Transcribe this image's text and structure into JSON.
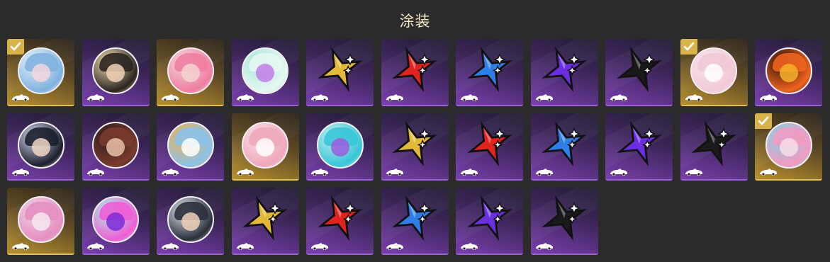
{
  "title": "涂装",
  "accent": "#d8b34c",
  "colors": {
    "gold": "#e4b937",
    "red": "#e0231f",
    "blue": "#2f7de6",
    "purple": "#6a2ee0",
    "black": "#1a1a1a"
  },
  "tiles": [
    {
      "type": "portrait",
      "frame": "gold",
      "selected": true,
      "icon": "character-portrait-icon",
      "palette": [
        "#e9f3fb",
        "#7fb2e0",
        "#f4d6df"
      ]
    },
    {
      "type": "portrait",
      "frame": "purple",
      "selected": false,
      "icon": "character-portrait-icon",
      "palette": [
        "#f3e2b3",
        "#2b2420",
        "#f2d2b6"
      ]
    },
    {
      "type": "portrait",
      "frame": "gold",
      "selected": false,
      "icon": "character-portrait-icon",
      "palette": [
        "#f4d7df",
        "#ef7ea0",
        "#f5d3d0"
      ]
    },
    {
      "type": "portrait",
      "frame": "purple",
      "selected": false,
      "icon": "abstract-emblem-icon",
      "palette": [
        "#a6e7dc",
        "#e6f7f1",
        "#c27de8"
      ]
    },
    {
      "type": "star",
      "frame": "purple",
      "selected": false,
      "icon": "gold-star-icon",
      "color": "gold"
    },
    {
      "type": "star",
      "frame": "purple",
      "selected": false,
      "icon": "red-star-icon",
      "color": "red"
    },
    {
      "type": "star",
      "frame": "purple",
      "selected": false,
      "icon": "blue-star-icon",
      "color": "blue"
    },
    {
      "type": "star",
      "frame": "purple",
      "selected": false,
      "icon": "purple-star-icon",
      "color": "purple"
    },
    {
      "type": "star",
      "frame": "purple",
      "selected": false,
      "icon": "black-star-icon",
      "color": "black"
    },
    {
      "type": "portrait",
      "frame": "gold",
      "selected": true,
      "icon": "character-portrait-icon",
      "palette": [
        "#f6e6ec",
        "#f2c9d6",
        "#ffffff"
      ]
    },
    {
      "type": "portrait",
      "frame": "purple",
      "selected": false,
      "icon": "fire-emblem-icon",
      "palette": [
        "#2a120e",
        "#f0641e",
        "#f6b12a"
      ]
    },
    {
      "type": "portrait",
      "frame": "purple",
      "selected": false,
      "icon": "character-portrait-icon",
      "palette": [
        "#d5d9ef",
        "#1b1e2c",
        "#f1d5c4"
      ]
    },
    {
      "type": "portrait",
      "frame": "purple",
      "selected": false,
      "icon": "character-portrait-icon",
      "palette": [
        "#2a1d1a",
        "#7a3a2e",
        "#e8c3a8"
      ]
    },
    {
      "type": "portrait",
      "frame": "purple",
      "selected": false,
      "icon": "character-portrait-icon",
      "palette": [
        "#f3b04a",
        "#8bc3ea",
        "#ffffff"
      ]
    },
    {
      "type": "portrait",
      "frame": "gold",
      "selected": false,
      "icon": "character-portrait-icon",
      "palette": [
        "#f6dfe6",
        "#f0a7bb",
        "#ffffff"
      ]
    },
    {
      "type": "portrait",
      "frame": "purple",
      "selected": false,
      "icon": "abstract-emblem-icon",
      "palette": [
        "#bff0ea",
        "#38c5d8",
        "#9b5ce0"
      ]
    },
    {
      "type": "star",
      "frame": "purple",
      "selected": false,
      "icon": "gold-star-icon",
      "color": "gold"
    },
    {
      "type": "star",
      "frame": "purple",
      "selected": false,
      "icon": "red-star-icon",
      "color": "red"
    },
    {
      "type": "star",
      "frame": "purple",
      "selected": false,
      "icon": "blue-star-icon",
      "color": "blue"
    },
    {
      "type": "star",
      "frame": "purple",
      "selected": false,
      "icon": "purple-star-icon",
      "color": "purple"
    },
    {
      "type": "star",
      "frame": "purple",
      "selected": false,
      "icon": "black-star-icon",
      "color": "black"
    },
    {
      "type": "portrait",
      "frame": "gold",
      "selected": true,
      "icon": "character-portrait-icon",
      "palette": [
        "#7fd3e8",
        "#f39ac0",
        "#f7dde8"
      ]
    },
    {
      "type": "portrait",
      "frame": "gold",
      "selected": false,
      "icon": "character-portrait-icon",
      "palette": [
        "#f1cfe3",
        "#e58fc1",
        "#f7e7f0"
      ]
    },
    {
      "type": "portrait",
      "frame": "purple",
      "selected": false,
      "icon": "cat-emblem-icon",
      "palette": [
        "#a9f0e4",
        "#f05cd6",
        "#7d2ad8"
      ]
    },
    {
      "type": "portrait",
      "frame": "purple",
      "selected": false,
      "icon": "character-portrait-icon",
      "palette": [
        "#d9e3ea",
        "#2a2f3a",
        "#f0d1b8"
      ]
    },
    {
      "type": "star",
      "frame": "purple",
      "selected": false,
      "icon": "gold-star-icon",
      "color": "gold"
    },
    {
      "type": "star",
      "frame": "purple",
      "selected": false,
      "icon": "red-star-icon",
      "color": "red"
    },
    {
      "type": "star",
      "frame": "purple",
      "selected": false,
      "icon": "blue-star-icon",
      "color": "blue"
    },
    {
      "type": "star",
      "frame": "purple",
      "selected": false,
      "icon": "purple-star-icon",
      "color": "purple"
    },
    {
      "type": "star",
      "frame": "purple",
      "selected": false,
      "icon": "black-star-icon",
      "color": "black"
    }
  ]
}
